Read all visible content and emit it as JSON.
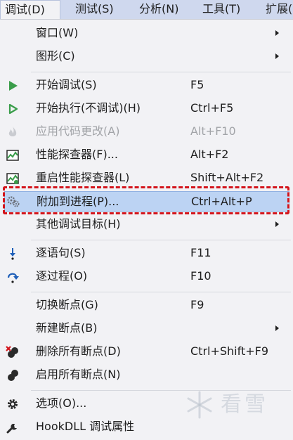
{
  "menubar": {
    "items": [
      {
        "label": "调试(D)"
      },
      {
        "label": "测试(S)"
      },
      {
        "label": "分析(N)"
      },
      {
        "label": "工具(T)"
      },
      {
        "label": "扩展("
      }
    ]
  },
  "menu": {
    "items": [
      {
        "label": "窗口(W)",
        "shortcut": "",
        "icon": "none",
        "submenu": true
      },
      {
        "label": "图形(C)",
        "shortcut": "",
        "icon": "none",
        "submenu": true
      },
      {
        "label": "开始调试(S)",
        "shortcut": "F5",
        "icon": "play-icon"
      },
      {
        "label": "开始执行(不调试)(H)",
        "shortcut": "Ctrl+F5",
        "icon": "play-outline-icon"
      },
      {
        "label": "应用代码更改(A)",
        "shortcut": "Alt+F10",
        "icon": "flame-icon",
        "disabled": true
      },
      {
        "label": "性能探查器(F)...",
        "shortcut": "Alt+F2",
        "icon": "performance-chart-icon"
      },
      {
        "label": "重启性能探查器(L)",
        "shortcut": "Shift+Alt+F2",
        "icon": "performance-restart-icon"
      },
      {
        "label": "附加到进程(P)...",
        "shortcut": "Ctrl+Alt+P",
        "icon": "gears-icon",
        "highlighted": true
      },
      {
        "label": "其他调试目标(H)",
        "shortcut": "",
        "icon": "none",
        "submenu": true
      },
      {
        "label": "逐语句(S)",
        "shortcut": "F11",
        "icon": "step-into-icon"
      },
      {
        "label": "逐过程(O)",
        "shortcut": "F10",
        "icon": "step-over-icon"
      },
      {
        "label": "切换断点(G)",
        "shortcut": "F9",
        "icon": "none"
      },
      {
        "label": "新建断点(B)",
        "shortcut": "",
        "icon": "none",
        "submenu": true
      },
      {
        "label": "删除所有断点(D)",
        "shortcut": "Ctrl+Shift+F9",
        "icon": "delete-breakpoints-icon"
      },
      {
        "label": "启用所有断点(N)",
        "shortcut": "",
        "icon": "enable-breakpoints-icon"
      },
      {
        "label": "选项(O)...",
        "shortcut": "",
        "icon": "gear-icon"
      },
      {
        "label": "HookDLL 调试属性",
        "shortcut": "",
        "icon": "wrench-icon"
      }
    ]
  },
  "watermark": {
    "text": "看雪"
  },
  "colors": {
    "menubar_bg": "#cfd8ee",
    "menu_bg": "#f2f2f5",
    "highlight_bg": "#bcd3f3",
    "annotation_red": "#d3141b",
    "play_green": "#3a9d4a",
    "disabled_text": "#a2a4a8"
  }
}
